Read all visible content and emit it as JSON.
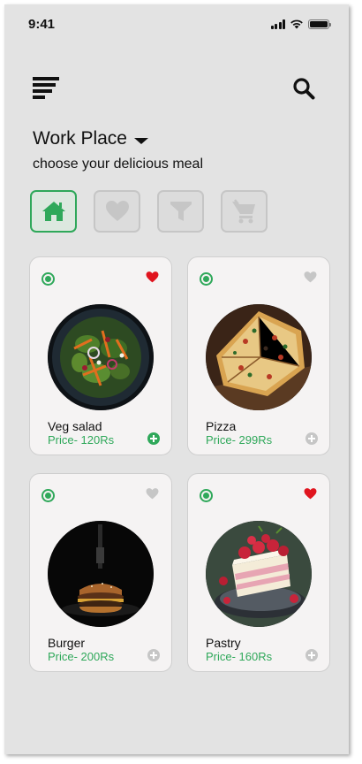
{
  "status_bar": {
    "time": "9:41"
  },
  "header": {
    "location": "Work Place",
    "subtitle": "choose your delicious meal"
  },
  "filters": [
    {
      "icon": "home-icon",
      "active": true
    },
    {
      "icon": "heart-icon",
      "active": false
    },
    {
      "icon": "filter-icon",
      "active": false
    },
    {
      "icon": "cart-icon",
      "active": false
    }
  ],
  "colors": {
    "accent": "#2fa85a",
    "favorite": "#e0141e",
    "inactive": "#c6c6c6"
  },
  "items": [
    {
      "name": "Veg salad",
      "price": "Price- 120Rs",
      "favorite": true,
      "added": true
    },
    {
      "name": "Pizza",
      "price": "Price- 299Rs",
      "favorite": false,
      "added": false
    },
    {
      "name": "Burger",
      "price": "Price- 200Rs",
      "favorite": false,
      "added": false
    },
    {
      "name": "Pastry",
      "price": "Price- 160Rs",
      "favorite": true,
      "added": false
    }
  ]
}
